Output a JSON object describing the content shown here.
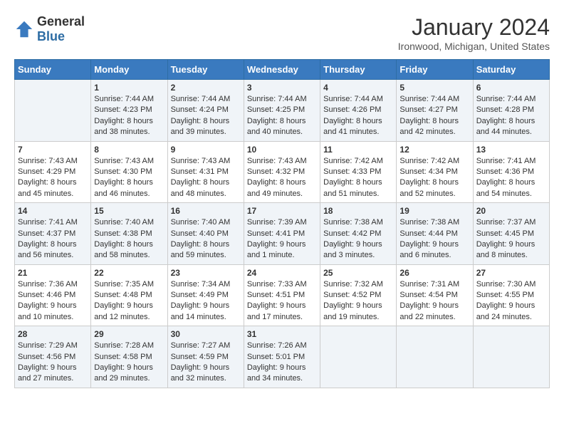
{
  "header": {
    "logo_general": "General",
    "logo_blue": "Blue",
    "title": "January 2024",
    "subtitle": "Ironwood, Michigan, United States"
  },
  "days_of_week": [
    "Sunday",
    "Monday",
    "Tuesday",
    "Wednesday",
    "Thursday",
    "Friday",
    "Saturday"
  ],
  "weeks": [
    [
      {
        "num": "",
        "sunrise": "",
        "sunset": "",
        "daylight": ""
      },
      {
        "num": "1",
        "sunrise": "Sunrise: 7:44 AM",
        "sunset": "Sunset: 4:23 PM",
        "daylight": "Daylight: 8 hours and 38 minutes."
      },
      {
        "num": "2",
        "sunrise": "Sunrise: 7:44 AM",
        "sunset": "Sunset: 4:24 PM",
        "daylight": "Daylight: 8 hours and 39 minutes."
      },
      {
        "num": "3",
        "sunrise": "Sunrise: 7:44 AM",
        "sunset": "Sunset: 4:25 PM",
        "daylight": "Daylight: 8 hours and 40 minutes."
      },
      {
        "num": "4",
        "sunrise": "Sunrise: 7:44 AM",
        "sunset": "Sunset: 4:26 PM",
        "daylight": "Daylight: 8 hours and 41 minutes."
      },
      {
        "num": "5",
        "sunrise": "Sunrise: 7:44 AM",
        "sunset": "Sunset: 4:27 PM",
        "daylight": "Daylight: 8 hours and 42 minutes."
      },
      {
        "num": "6",
        "sunrise": "Sunrise: 7:44 AM",
        "sunset": "Sunset: 4:28 PM",
        "daylight": "Daylight: 8 hours and 44 minutes."
      }
    ],
    [
      {
        "num": "7",
        "sunrise": "Sunrise: 7:43 AM",
        "sunset": "Sunset: 4:29 PM",
        "daylight": "Daylight: 8 hours and 45 minutes."
      },
      {
        "num": "8",
        "sunrise": "Sunrise: 7:43 AM",
        "sunset": "Sunset: 4:30 PM",
        "daylight": "Daylight: 8 hours and 46 minutes."
      },
      {
        "num": "9",
        "sunrise": "Sunrise: 7:43 AM",
        "sunset": "Sunset: 4:31 PM",
        "daylight": "Daylight: 8 hours and 48 minutes."
      },
      {
        "num": "10",
        "sunrise": "Sunrise: 7:43 AM",
        "sunset": "Sunset: 4:32 PM",
        "daylight": "Daylight: 8 hours and 49 minutes."
      },
      {
        "num": "11",
        "sunrise": "Sunrise: 7:42 AM",
        "sunset": "Sunset: 4:33 PM",
        "daylight": "Daylight: 8 hours and 51 minutes."
      },
      {
        "num": "12",
        "sunrise": "Sunrise: 7:42 AM",
        "sunset": "Sunset: 4:34 PM",
        "daylight": "Daylight: 8 hours and 52 minutes."
      },
      {
        "num": "13",
        "sunrise": "Sunrise: 7:41 AM",
        "sunset": "Sunset: 4:36 PM",
        "daylight": "Daylight: 8 hours and 54 minutes."
      }
    ],
    [
      {
        "num": "14",
        "sunrise": "Sunrise: 7:41 AM",
        "sunset": "Sunset: 4:37 PM",
        "daylight": "Daylight: 8 hours and 56 minutes."
      },
      {
        "num": "15",
        "sunrise": "Sunrise: 7:40 AM",
        "sunset": "Sunset: 4:38 PM",
        "daylight": "Daylight: 8 hours and 58 minutes."
      },
      {
        "num": "16",
        "sunrise": "Sunrise: 7:40 AM",
        "sunset": "Sunset: 4:40 PM",
        "daylight": "Daylight: 8 hours and 59 minutes."
      },
      {
        "num": "17",
        "sunrise": "Sunrise: 7:39 AM",
        "sunset": "Sunset: 4:41 PM",
        "daylight": "Daylight: 9 hours and 1 minute."
      },
      {
        "num": "18",
        "sunrise": "Sunrise: 7:38 AM",
        "sunset": "Sunset: 4:42 PM",
        "daylight": "Daylight: 9 hours and 3 minutes."
      },
      {
        "num": "19",
        "sunrise": "Sunrise: 7:38 AM",
        "sunset": "Sunset: 4:44 PM",
        "daylight": "Daylight: 9 hours and 6 minutes."
      },
      {
        "num": "20",
        "sunrise": "Sunrise: 7:37 AM",
        "sunset": "Sunset: 4:45 PM",
        "daylight": "Daylight: 9 hours and 8 minutes."
      }
    ],
    [
      {
        "num": "21",
        "sunrise": "Sunrise: 7:36 AM",
        "sunset": "Sunset: 4:46 PM",
        "daylight": "Daylight: 9 hours and 10 minutes."
      },
      {
        "num": "22",
        "sunrise": "Sunrise: 7:35 AM",
        "sunset": "Sunset: 4:48 PM",
        "daylight": "Daylight: 9 hours and 12 minutes."
      },
      {
        "num": "23",
        "sunrise": "Sunrise: 7:34 AM",
        "sunset": "Sunset: 4:49 PM",
        "daylight": "Daylight: 9 hours and 14 minutes."
      },
      {
        "num": "24",
        "sunrise": "Sunrise: 7:33 AM",
        "sunset": "Sunset: 4:51 PM",
        "daylight": "Daylight: 9 hours and 17 minutes."
      },
      {
        "num": "25",
        "sunrise": "Sunrise: 7:32 AM",
        "sunset": "Sunset: 4:52 PM",
        "daylight": "Daylight: 9 hours and 19 minutes."
      },
      {
        "num": "26",
        "sunrise": "Sunrise: 7:31 AM",
        "sunset": "Sunset: 4:54 PM",
        "daylight": "Daylight: 9 hours and 22 minutes."
      },
      {
        "num": "27",
        "sunrise": "Sunrise: 7:30 AM",
        "sunset": "Sunset: 4:55 PM",
        "daylight": "Daylight: 9 hours and 24 minutes."
      }
    ],
    [
      {
        "num": "28",
        "sunrise": "Sunrise: 7:29 AM",
        "sunset": "Sunset: 4:56 PM",
        "daylight": "Daylight: 9 hours and 27 minutes."
      },
      {
        "num": "29",
        "sunrise": "Sunrise: 7:28 AM",
        "sunset": "Sunset: 4:58 PM",
        "daylight": "Daylight: 9 hours and 29 minutes."
      },
      {
        "num": "30",
        "sunrise": "Sunrise: 7:27 AM",
        "sunset": "Sunset: 4:59 PM",
        "daylight": "Daylight: 9 hours and 32 minutes."
      },
      {
        "num": "31",
        "sunrise": "Sunrise: 7:26 AM",
        "sunset": "Sunset: 5:01 PM",
        "daylight": "Daylight: 9 hours and 34 minutes."
      },
      {
        "num": "",
        "sunrise": "",
        "sunset": "",
        "daylight": ""
      },
      {
        "num": "",
        "sunrise": "",
        "sunset": "",
        "daylight": ""
      },
      {
        "num": "",
        "sunrise": "",
        "sunset": "",
        "daylight": ""
      }
    ]
  ]
}
